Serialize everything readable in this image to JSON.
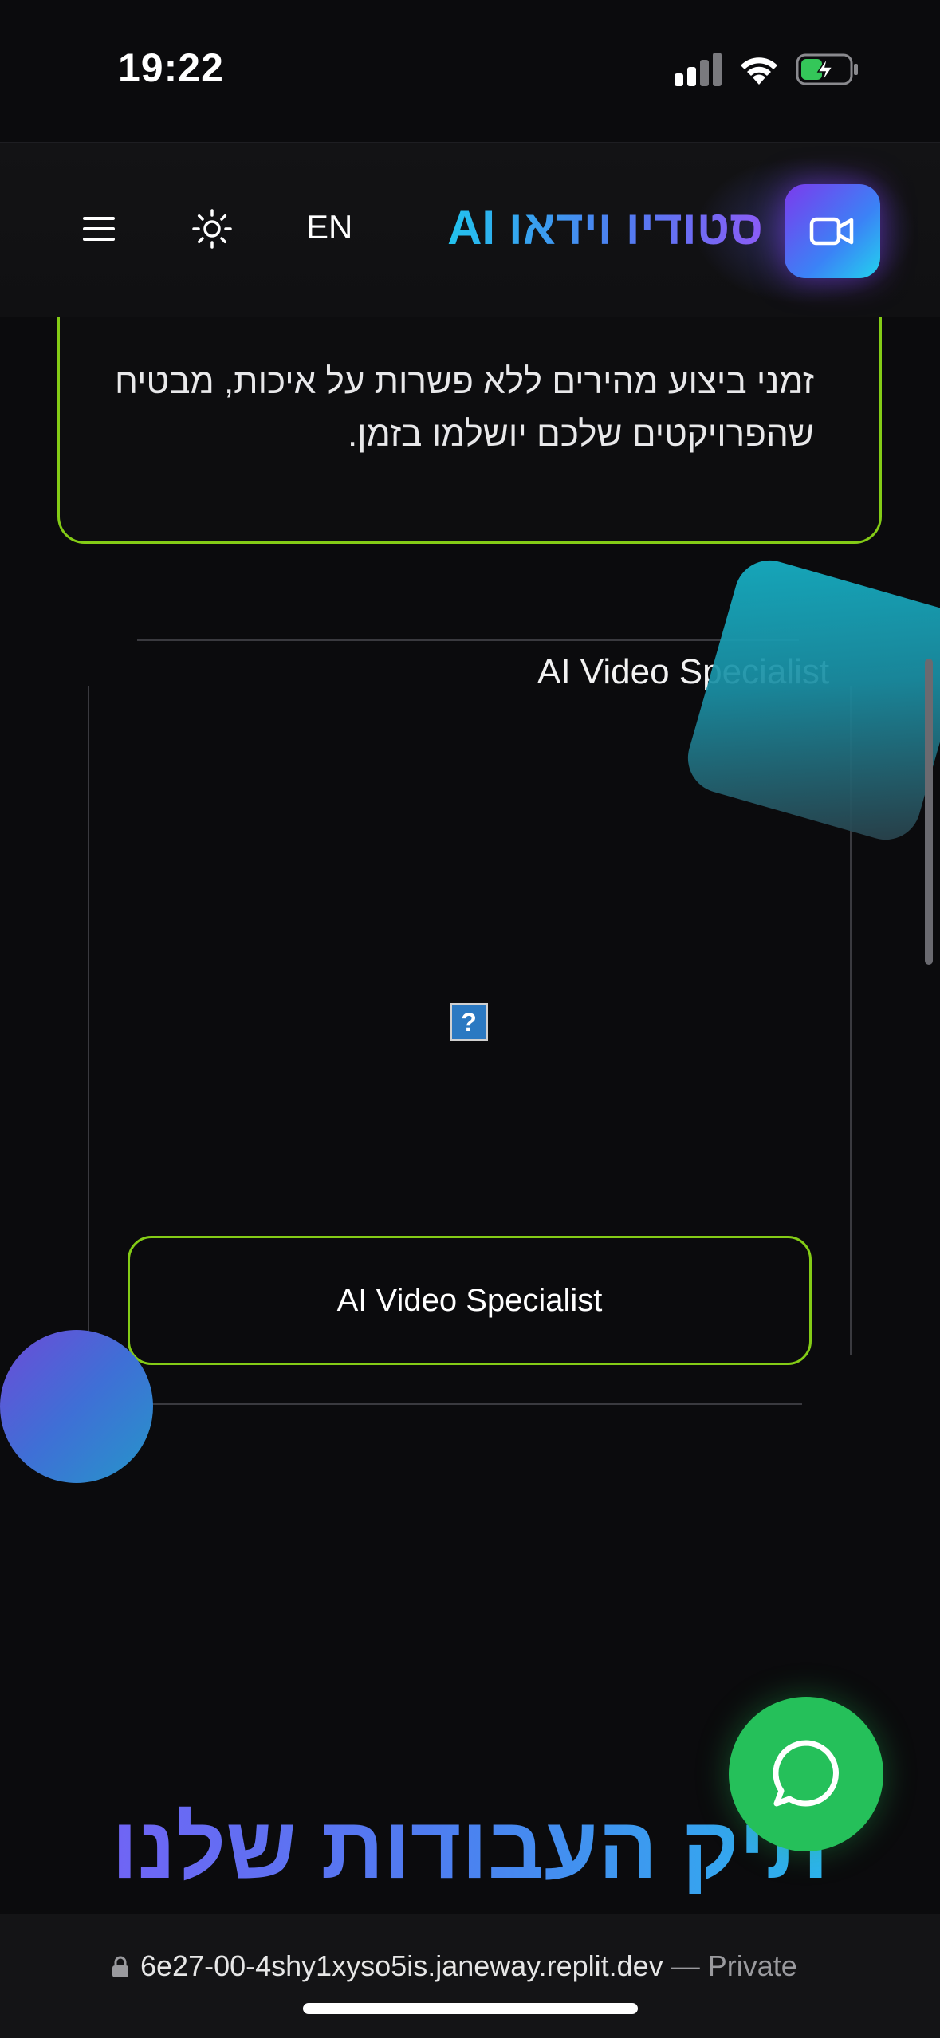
{
  "status_bar": {
    "time": "19:22"
  },
  "header": {
    "brand_title": "סטודיו וידאו AI",
    "lang_label": "EN",
    "logo_icon": "video-camera-icon",
    "theme_icon": "sun-icon",
    "menu_icon": "hamburger-menu-icon"
  },
  "feature_card": {
    "text": "זמני ביצוע מהירים ללא פשרות על איכות, מבטיח שהפרויקטים שלכם יושלמו בזמן."
  },
  "portfolio_item": {
    "title": "AI Video Specialist",
    "image_placeholder": "?",
    "button_label": "AI Video Specialist"
  },
  "section": {
    "title": "תיק העבודות שלנו"
  },
  "browser": {
    "url": "6e27-00-4shy1xyso5is.janeway.replit.dev",
    "privacy_label": " — Private"
  },
  "colors": {
    "accent_green": "#84cc16",
    "gradient_cyan": "#22c3ee",
    "gradient_purple": "#8b5cf6",
    "whatsapp_green": "#25c05a"
  }
}
